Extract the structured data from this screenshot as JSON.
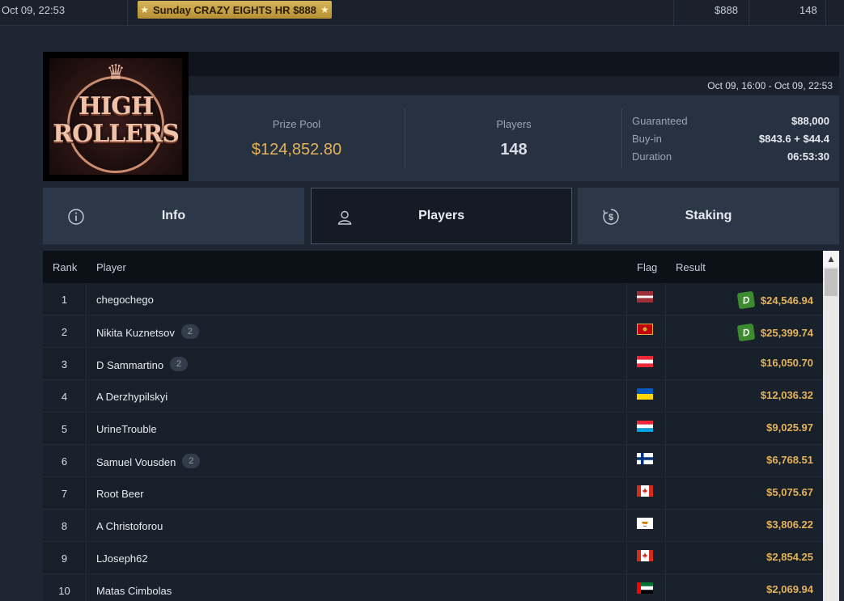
{
  "top_row": {
    "date": "Oct 09, 22:53",
    "tournament": "Sunday CRAZY EIGHTS HR $888",
    "prize": "$888",
    "entries": "148"
  },
  "header": {
    "logo": {
      "line1": "HIGH",
      "line2": "ROLLERS"
    },
    "date_range": "Oct 09, 16:00 - Oct 09, 22:53",
    "prize_pool": {
      "label": "Prize Pool",
      "value": "$124,852.80"
    },
    "players": {
      "label": "Players",
      "value": "148"
    },
    "guaranteed": {
      "label": "Guaranteed",
      "value": "$88,000"
    },
    "buyin": {
      "label": "Buy-in",
      "value": "$843.6 + $44.4"
    },
    "duration": {
      "label": "Duration",
      "value": "06:53:30"
    }
  },
  "tabs": {
    "info": {
      "label": "Info",
      "icon": "info-circle-icon"
    },
    "players": {
      "label": "Players",
      "icon": "user-icon",
      "active": true
    },
    "staking": {
      "label": "Staking",
      "icon": "dollar-refresh-icon"
    }
  },
  "table": {
    "columns": {
      "rank": "Rank",
      "player": "Player",
      "flag": "Flag",
      "result": "Result"
    },
    "rows": [
      {
        "rank": "1",
        "player": "chegochego",
        "count": "",
        "flag": "latvia",
        "result": "$24,546.94",
        "d_badge": "D"
      },
      {
        "rank": "2",
        "player": "Nikita Kuznetsov",
        "count": "2",
        "flag": "montenegro",
        "result": "$25,399.74",
        "d_badge": "D"
      },
      {
        "rank": "3",
        "player": "D Sammartino",
        "count": "2",
        "flag": "austria",
        "result": "$16,050.70",
        "d_badge": ""
      },
      {
        "rank": "4",
        "player": "A Derzhypilskyi",
        "count": "",
        "flag": "ukraine",
        "result": "$12,036.32",
        "d_badge": ""
      },
      {
        "rank": "5",
        "player": "UrineTrouble",
        "count": "",
        "flag": "luxembourg",
        "result": "$9,025.97",
        "d_badge": ""
      },
      {
        "rank": "6",
        "player": "Samuel Vousden",
        "count": "2",
        "flag": "finland",
        "result": "$6,768.51",
        "d_badge": ""
      },
      {
        "rank": "7",
        "player": "Root Beer",
        "count": "",
        "flag": "canada",
        "result": "$5,075.67",
        "d_badge": ""
      },
      {
        "rank": "8",
        "player": "A Christoforou",
        "count": "",
        "flag": "cyprus",
        "result": "$3,806.22",
        "d_badge": ""
      },
      {
        "rank": "9",
        "player": "LJoseph62",
        "count": "",
        "flag": "canada",
        "result": "$2,854.25",
        "d_badge": ""
      },
      {
        "rank": "10",
        "player": "Matas Cimbolas",
        "count": "",
        "flag": "uae",
        "result": "$2,069.94",
        "d_badge": ""
      }
    ]
  },
  "colors": {
    "accent_gold": "#e4b25a",
    "background": "#1e2633",
    "d_badge": "#3e8a2e"
  }
}
